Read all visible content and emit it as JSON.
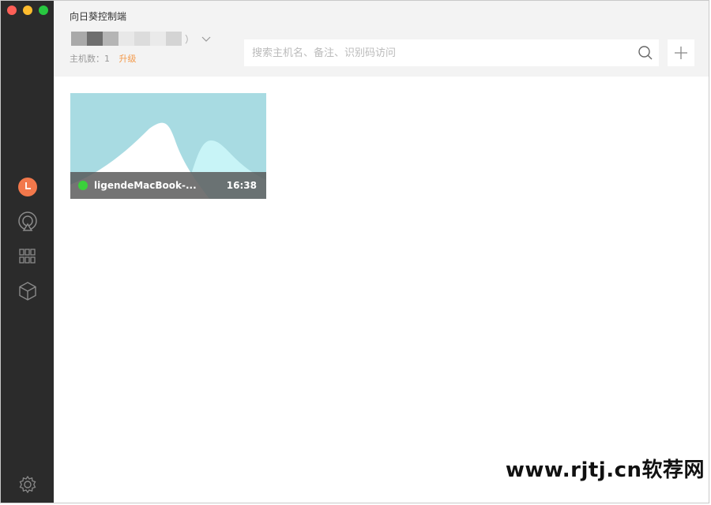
{
  "window": {
    "title": "向日葵控制端"
  },
  "account": {
    "name_suffix": "）",
    "host_count_label": "主机数：",
    "host_count": "1",
    "upgrade_label": "升级"
  },
  "search": {
    "placeholder": "搜索主机名、备注、识别码访问"
  },
  "hosts": [
    {
      "name": "ligendeMacBook-...",
      "time": "16:38",
      "status": "online"
    }
  ],
  "watermark": "www.rjtj.cn软荐网",
  "colors": {
    "sidebar": "#2b2b2b",
    "accent": "#f39a4b",
    "online": "#3bd03b",
    "thumb_bg": "#a8dbe2"
  }
}
